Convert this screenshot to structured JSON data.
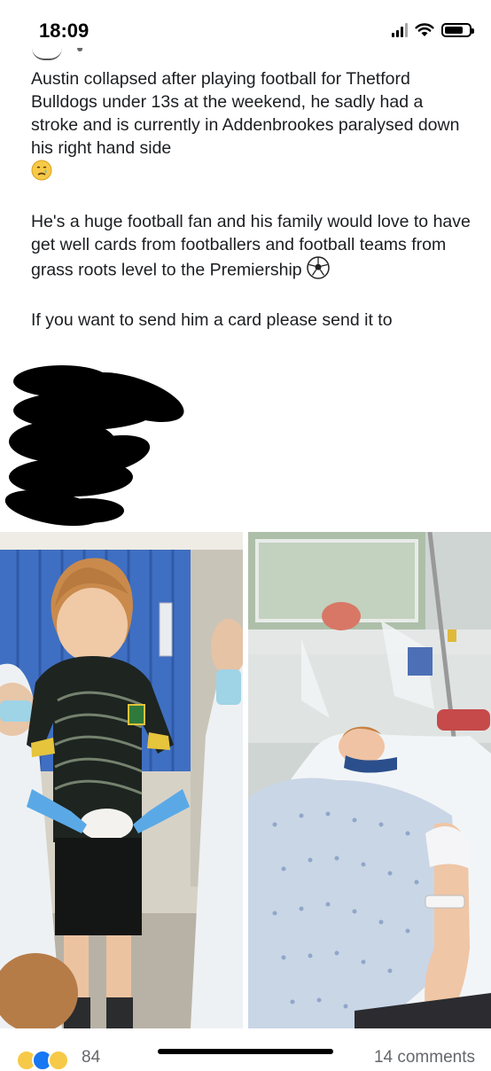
{
  "status_bar": {
    "time": "18:09",
    "battery_level": 0.75
  },
  "post": {
    "paragraphs": [
      {
        "text": "Austin collapsed after playing football for Thetford Bulldogs under 13s at the weekend, he sadly had a stroke and is currently in Addenbrookes paralysed down his right hand side",
        "emoji": "crying-face"
      },
      {
        "text": "He's a huge football fan and his family would love to have get well cards from footballers and football teams from grass roots level to the Premiership",
        "emoji": "soccer-ball"
      },
      {
        "text": "If you want to send him a card please send it to"
      }
    ]
  },
  "footer": {
    "reaction_count": "84",
    "comment_count": "14 comments"
  }
}
